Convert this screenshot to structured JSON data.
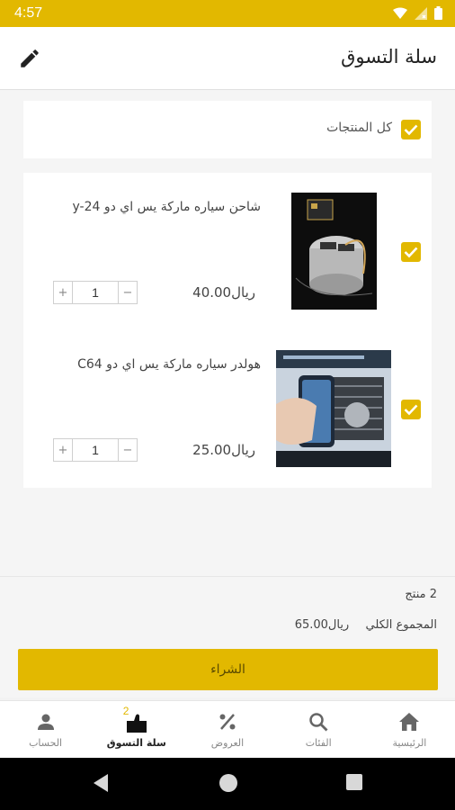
{
  "status_bar": {
    "time": "4:57"
  },
  "app_bar": {
    "title": "سلة التسوق"
  },
  "select_all": {
    "label": "كل المنتجات",
    "checked": true
  },
  "cart_items": [
    {
      "title": "شاحن  سياره ماركة يس اي دو y-24",
      "price": "ريال40.00",
      "quantity": "1",
      "checked": true
    },
    {
      "title": "هولدر سياره ماركة يس اي دو C64",
      "price": "ريال25.00",
      "quantity": "1",
      "checked": true
    }
  ],
  "stepper": {
    "minus": "−",
    "plus": "+"
  },
  "summary": {
    "count": "2 منتج",
    "total_label": "المجموع الكلي",
    "total_value": "ريال65.00"
  },
  "buy_button": {
    "label": "الشراء"
  },
  "bottom_nav": {
    "items": [
      {
        "label": "الرئيسية",
        "icon": "home-icon"
      },
      {
        "label": "الفئات",
        "icon": "search-icon"
      },
      {
        "label": "العروض",
        "icon": "percent-icon"
      },
      {
        "label": "سلة التسوق",
        "icon": "cart-icon",
        "badge": "2",
        "active": true
      },
      {
        "label": "الحساب",
        "icon": "person-icon"
      }
    ]
  },
  "colors": {
    "accent": "#e2b800",
    "background": "#f5f5f5"
  }
}
